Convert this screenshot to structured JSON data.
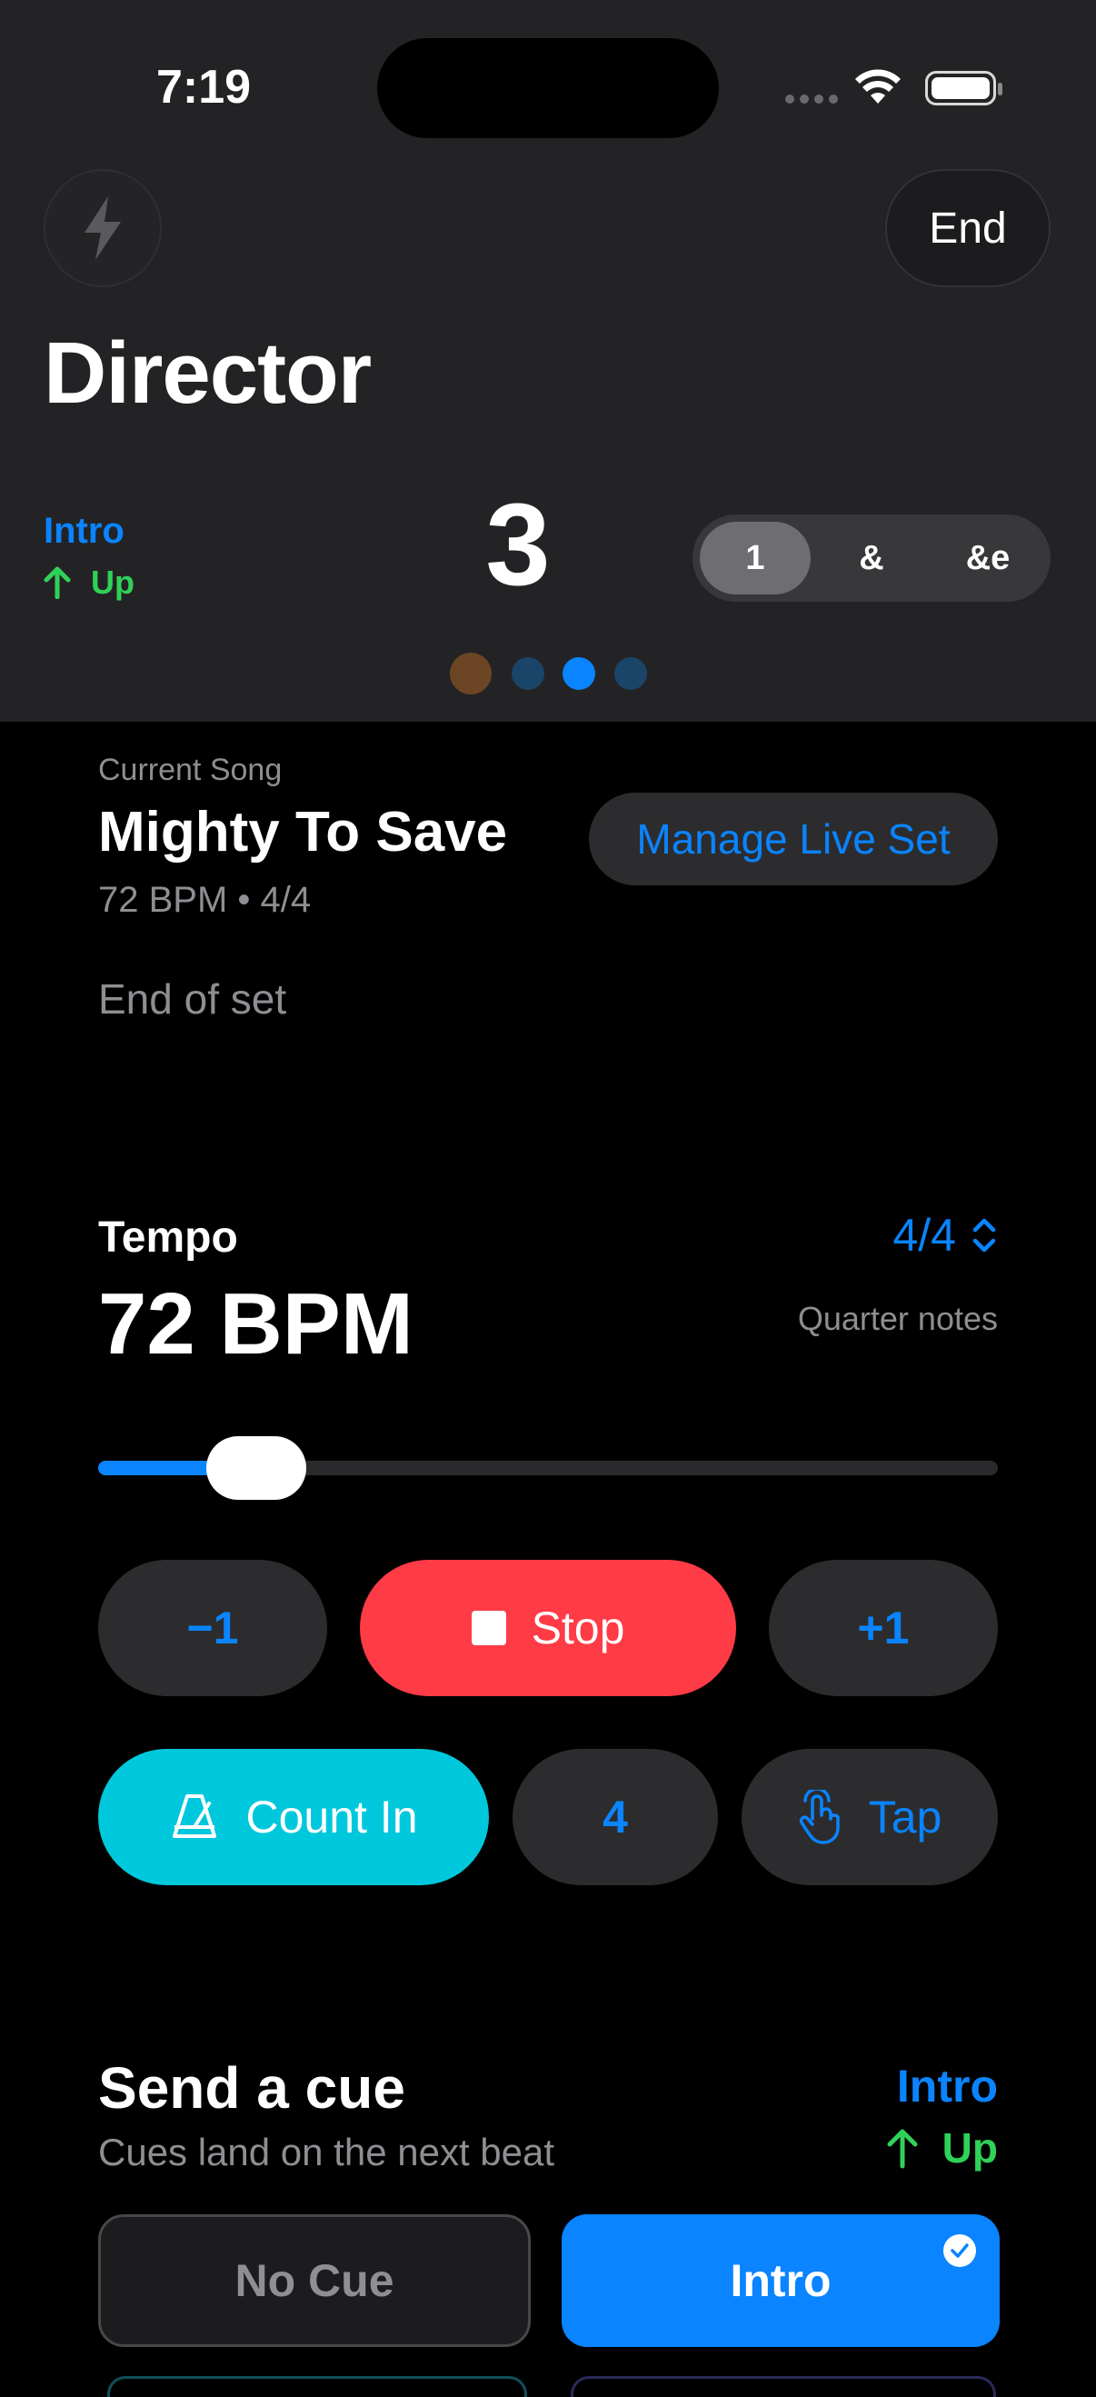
{
  "status_bar": {
    "time": "7:19"
  },
  "header": {
    "flash_icon": "lightning-bolt-icon",
    "end_label": "End",
    "title": "Director",
    "cue_name": "Intro",
    "cue_direction": "Up",
    "beat_number": "3",
    "subdivision_options": [
      "1",
      "&",
      "&e"
    ],
    "subdivision_selected": "1",
    "page_dots": [
      "#6b4524",
      "#1b4469",
      "#0a84ff",
      "#1b4469"
    ]
  },
  "song": {
    "label": "Current Song",
    "title": "Mighty To Save",
    "meta": "72 BPM • 4/4",
    "manage_label": "Manage Live Set",
    "end_of_set": "End of set"
  },
  "tempo": {
    "label": "Tempo",
    "value": "72 BPM",
    "meter": "4/4",
    "note_value": "Quarter notes",
    "slider_fraction": 0.12,
    "minus_label": "−1",
    "stop_label": "Stop",
    "plus_label": "+1",
    "count_in_label": "Count In",
    "count_in_beats": "4",
    "tap_label": "Tap"
  },
  "cue": {
    "title": "Send a cue",
    "subtitle": "Cues land on the next beat",
    "current_name": "Intro",
    "current_direction": "Up",
    "options": [
      "No Cue",
      "Intro"
    ],
    "selected": "Intro"
  },
  "colors": {
    "accent": "#0a84ff",
    "green": "#30d158",
    "red": "#ff3b45",
    "cyan": "#00c8dc"
  }
}
